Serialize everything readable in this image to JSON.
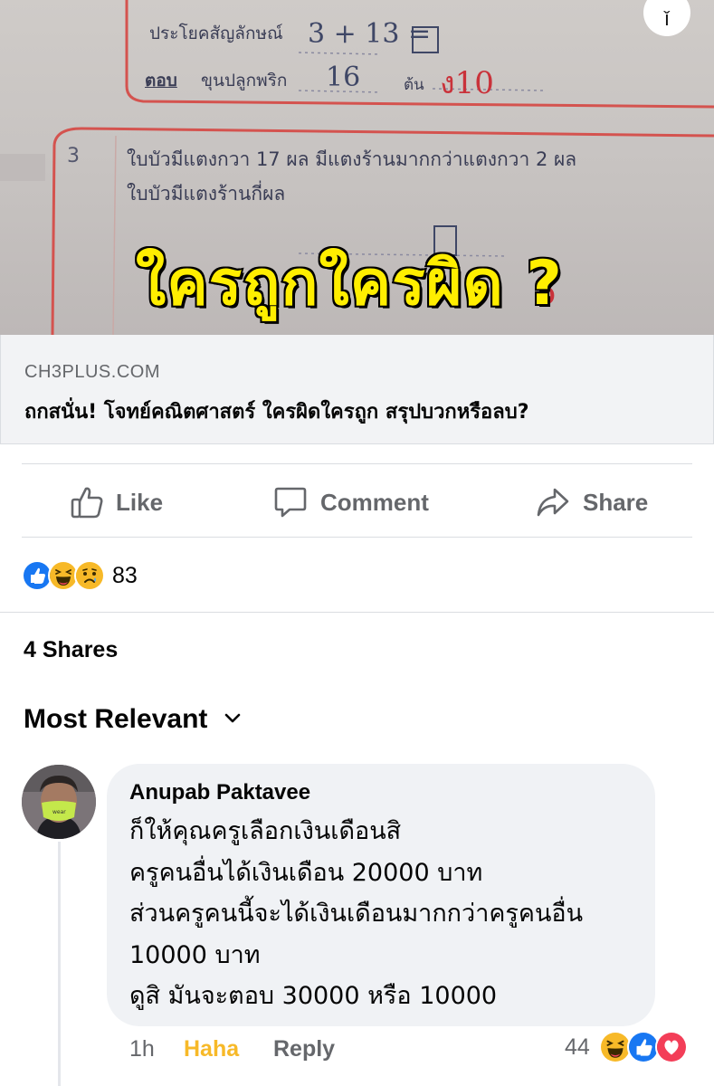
{
  "preview": {
    "overlay_text": "ใครถูกใครผิด ?",
    "worksheet": {
      "label_sentence": "ประโยคสัญลักษณ์",
      "label_answer": "ตอบ",
      "answer_unit_text": "ขุนปลูกพริก",
      "tree_unit": "ต้น",
      "question_number": "3",
      "question_line1": "ใบบัวมีแตงกวา 17 ผล มีแตงร้านมากกว่าแตงกวา 2 ผล",
      "question_line2": "ใบบัวมีแตงร้านกี่ผล",
      "hw_equation": "3 + 13 =",
      "hw_answer": "16",
      "red_mark": "ง10",
      "red_mark2": "5"
    }
  },
  "link": {
    "domain": "CH3PLUS.COM",
    "title": "ถกสนั่น! โจทย์คณิตศาสตร์ ใครผิดใครถูก สรุปบวกหรือลบ?"
  },
  "actions": {
    "like": "Like",
    "comment": "Comment",
    "share": "Share"
  },
  "reactions": {
    "count": "83",
    "icons": [
      "like-icon",
      "haha-icon",
      "sad-icon"
    ]
  },
  "shares": "4 Shares",
  "sort": {
    "label": "Most Relevant"
  },
  "comment": {
    "author": "Anupab Paktavee",
    "lines": [
      "ก็ให้คุณครูเลือกเงินเดือนสิ",
      "ครูคนอื่นได้เงินเดือน 20000 บาท",
      "ส่วนครูคนนี้จะได้เงินเดือนมากกว่าครูคนอื่น",
      "10000 บาท",
      "ดูสิ มันจะตอบ 30000 หรือ 10000"
    ],
    "time": "1h",
    "haha": "Haha",
    "reply": "Reply",
    "reaction_count": "44",
    "reaction_icons": [
      "haha-icon",
      "like-icon",
      "love-icon"
    ]
  },
  "colors": {
    "secondary_text": "#65676b",
    "haha_action": "#f7b928",
    "link_bg": "#f2f3f5",
    "bubble_bg": "#f0f2f5",
    "like_blue": "#1877f2",
    "love_red": "#f33e58",
    "overlay_yellow": "#ffee00"
  }
}
